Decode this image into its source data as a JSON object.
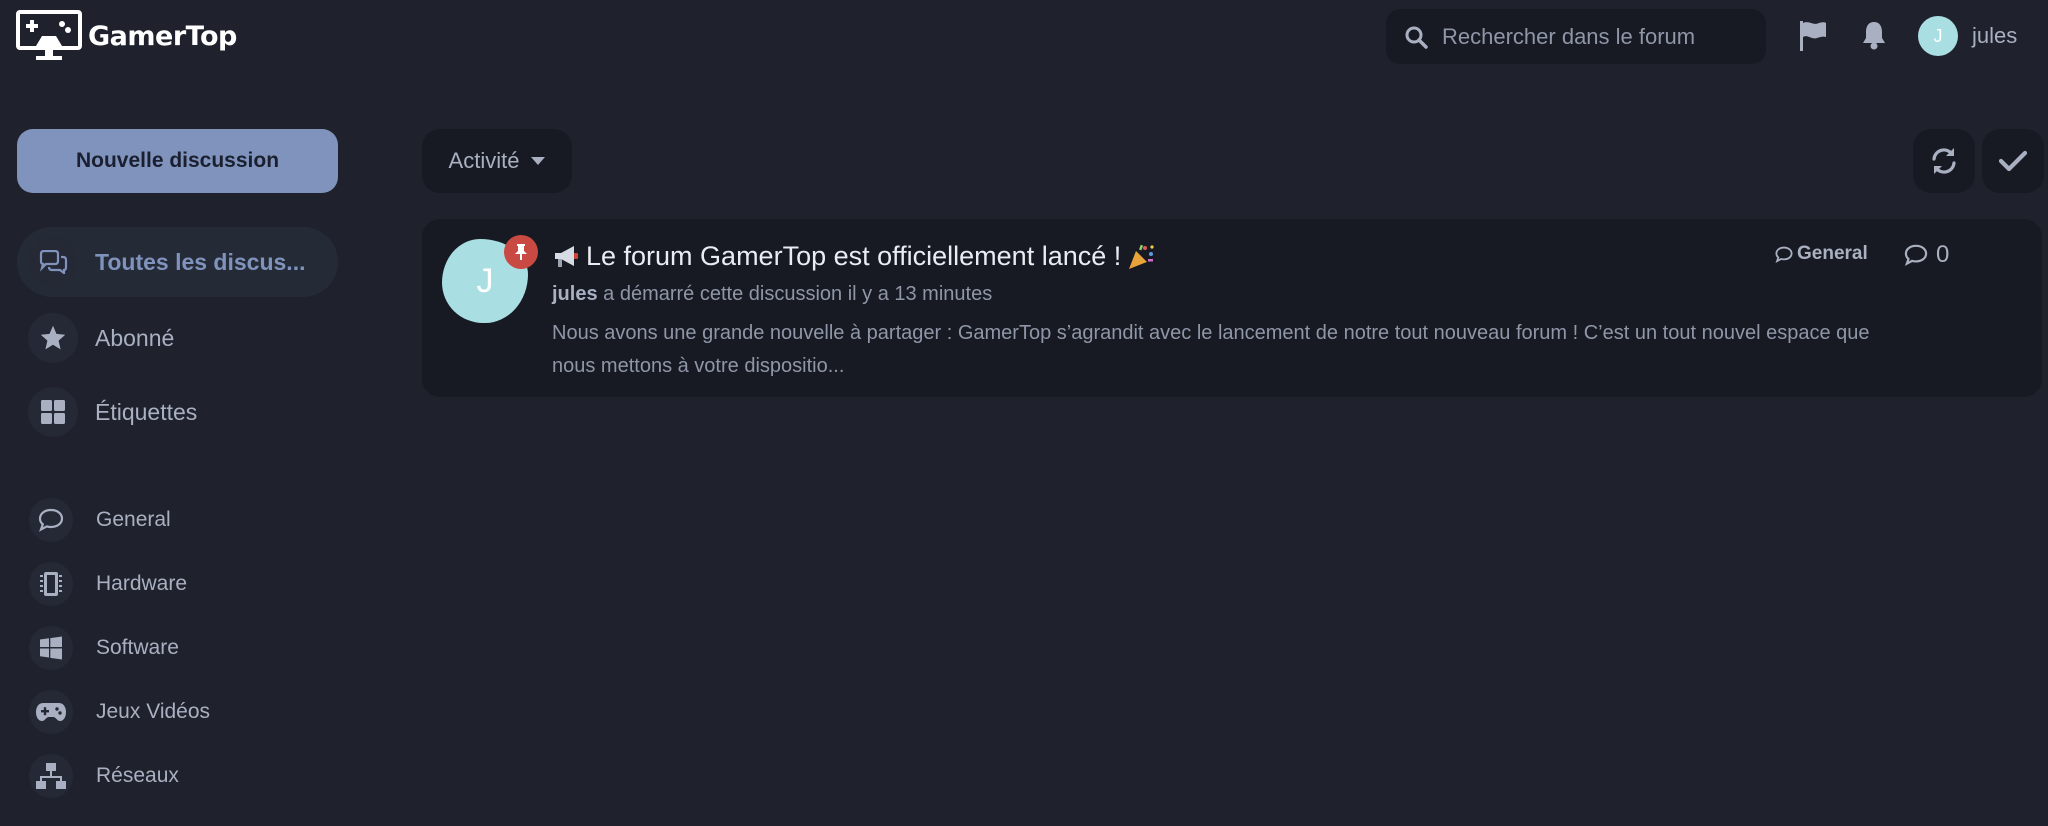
{
  "app": {
    "name": "GamerTop"
  },
  "header": {
    "search_placeholder": "Rechercher dans le forum",
    "user": {
      "initial": "J",
      "name": "jules",
      "avatar_color": "#a9dfe2"
    }
  },
  "sidebar": {
    "new_discussion_label": "Nouvelle discussion",
    "nav": [
      {
        "label": "Toutes les discus...",
        "icon": "comments-icon",
        "active": true
      },
      {
        "label": "Abonné",
        "icon": "star-icon",
        "active": false
      },
      {
        "label": "Étiquettes",
        "icon": "grid-icon",
        "active": false
      }
    ],
    "tags": [
      {
        "label": "General",
        "icon": "comment-icon"
      },
      {
        "label": "Hardware",
        "icon": "memory-icon"
      },
      {
        "label": "Software",
        "icon": "windows-icon"
      },
      {
        "label": "Jeux Vidéos",
        "icon": "gamepad-icon"
      },
      {
        "label": "Réseaux",
        "icon": "network-icon"
      }
    ]
  },
  "toolbar": {
    "sort_label": "Activité"
  },
  "discussions": [
    {
      "title": "Le forum GamerTop est officiellement lancé !",
      "author_initial": "J",
      "author": "jules",
      "meta_text": "a démarré cette discussion il y a 13 minutes",
      "excerpt": "Nous avons une grande nouvelle à partager : GamerTop s’agrandit avec le lancement de notre tout nouveau forum ! C’est un tout nouvel espace que nous mettons à votre dispositio...",
      "tag": "General",
      "replies": "0",
      "pinned": true
    }
  ],
  "colors": {
    "background": "#1f222d",
    "accent": "#7f93bd",
    "panel": "#171a22",
    "pin": "#c94a42"
  }
}
